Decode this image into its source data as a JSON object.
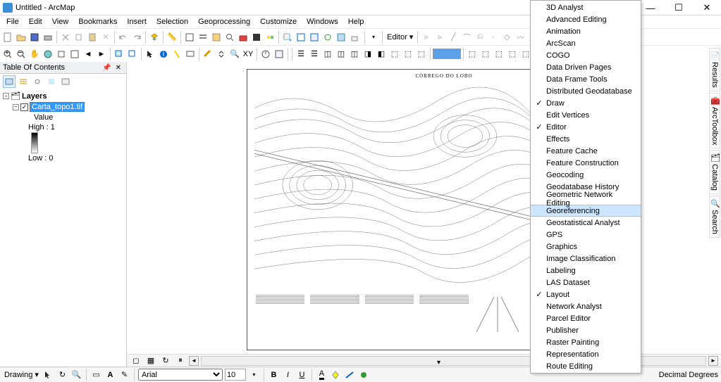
{
  "window": {
    "title": "Untitled - ArcMap"
  },
  "menus": [
    "File",
    "Edit",
    "View",
    "Bookmarks",
    "Insert",
    "Selection",
    "Geoprocessing",
    "Customize",
    "Windows",
    "Help"
  ],
  "toolbar": {
    "editor_label": "Editor"
  },
  "toc": {
    "title": "Table Of Contents",
    "root": "Layers",
    "layer": "Carta_topo1.tif",
    "value_label": "Value",
    "high": "High : 1",
    "low": "Low : 0"
  },
  "map": {
    "title": "CÓRREGO DO LOBO"
  },
  "drawing": {
    "label": "Drawing",
    "font": "Arial",
    "size": "10"
  },
  "status": {
    "units": "Decimal Degrees"
  },
  "side_tabs": [
    "Results",
    "ArcToolbox",
    "Catalog",
    "Search"
  ],
  "toolbars_menu": {
    "items": [
      {
        "label": "3D Analyst",
        "checked": false
      },
      {
        "label": "Advanced Editing",
        "checked": false
      },
      {
        "label": "Animation",
        "checked": false
      },
      {
        "label": "ArcScan",
        "checked": false
      },
      {
        "label": "COGO",
        "checked": false
      },
      {
        "label": "Data Driven Pages",
        "checked": false
      },
      {
        "label": "Data Frame Tools",
        "checked": false
      },
      {
        "label": "Distributed Geodatabase",
        "checked": false
      },
      {
        "label": "Draw",
        "checked": true
      },
      {
        "label": "Edit Vertices",
        "checked": false
      },
      {
        "label": "Editor",
        "checked": true
      },
      {
        "label": "Effects",
        "checked": false
      },
      {
        "label": "Feature Cache",
        "checked": false
      },
      {
        "label": "Feature Construction",
        "checked": false
      },
      {
        "label": "Geocoding",
        "checked": false
      },
      {
        "label": "Geodatabase History",
        "checked": false
      },
      {
        "label": "Geometric Network Editing",
        "checked": false
      },
      {
        "label": "Georeferencing",
        "checked": false,
        "highlight": true
      },
      {
        "label": "Geostatistical Analyst",
        "checked": false
      },
      {
        "label": "GPS",
        "checked": false
      },
      {
        "label": "Graphics",
        "checked": false
      },
      {
        "label": "Image Classification",
        "checked": false
      },
      {
        "label": "Labeling",
        "checked": false
      },
      {
        "label": "LAS Dataset",
        "checked": false
      },
      {
        "label": "Layout",
        "checked": true
      },
      {
        "label": "Network Analyst",
        "checked": false
      },
      {
        "label": "Parcel Editor",
        "checked": false
      },
      {
        "label": "Publisher",
        "checked": false
      },
      {
        "label": "Raster Painting",
        "checked": false
      },
      {
        "label": "Representation",
        "checked": false
      },
      {
        "label": "Route Editing",
        "checked": false
      }
    ]
  }
}
